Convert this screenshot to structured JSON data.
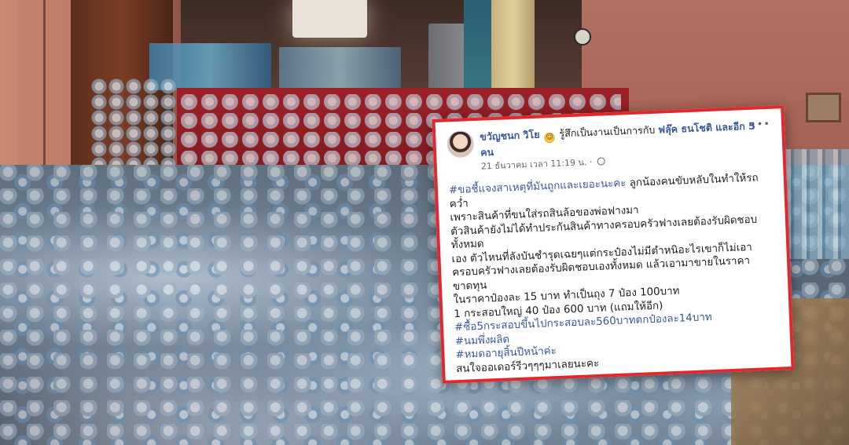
{
  "post": {
    "author": "ขวัญชนก วิโย",
    "feeling_emoji": "smiling-face-icon",
    "feeling_text": "รู้สึกเป็นงานเป็นการกับ",
    "tagged": "ฟลุ๊ค ธนโชติ และอีก 5 คน",
    "timestamp": "21 ธันวาคม เวลา 11:19 น.",
    "privacy": "globe-icon",
    "lines": {
      "l1": "#ขอชี้แจงสาเหตุที่มันถูกและเยอะนะคะ",
      "l1b": "ลูกน้องคนขับหลับในทำให้รถคว่ำ",
      "l2": "เพราะสินค้าที่ขนใส่รถสินล้อของพ่อฟางมา",
      "l3": "ตัวสินค้ายังไม่ได้ทำประกันสินค้าทางครอบครัวฟางเลยต้องรับผิดชอบทั้งหมด",
      "l4": "เอง ตัวไหนที่ลังบันชำรุดเฉยๆแต่กระป๋องไม่มีตำหนิอะไรเขาก็ไม่เอา",
      "l5": "ครอบครัวฟางเลยต้องรับผิดชอบเองทั้งหมด แล้วเอามาขายในราคาขาดทุน",
      "l6": "ในราคาป๋องละ 15 บาท ทำเป็นถุง 7 ป๋อง 100บาท",
      "l7": "1 กระสอบใหญ่ 40 ป๋อง 600 บาท (แถมให้อีก)",
      "l8": "#ซื้อ5กระสอบขึ้นไปกระสอบละ560บาทตกป๋องละ14บาท",
      "l9": "#นมพึ่งผลิต",
      "l10": "#หมดอายุสิ้นปีหน้าค่ะ",
      "l11": "สนใจออเดอร์รีวๆๆๆมาเลยนะคะ"
    }
  }
}
